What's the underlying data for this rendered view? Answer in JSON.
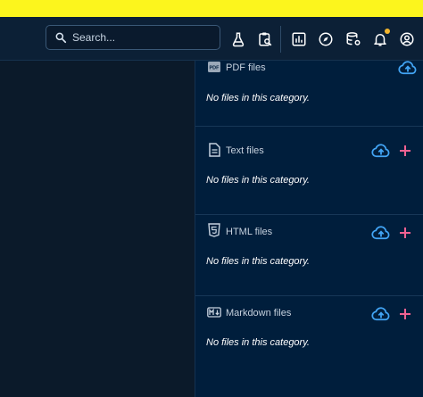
{
  "search": {
    "placeholder": "Search..."
  },
  "header_icons": [
    "flask-icon",
    "clipboard-search-icon",
    "chart-icon",
    "compass-icon",
    "database-settings-icon",
    "bell-icon",
    "account-icon"
  ],
  "colors": {
    "banner": "#fcf51d",
    "accent_blue": "#42a5f5",
    "accent_pink": "#f06292",
    "badge": "#f3b52d"
  },
  "sections": [
    {
      "title": "PDF files",
      "empty": "No files in this category.",
      "icon": "pdf-icon"
    },
    {
      "title": "Text files",
      "empty": "No files in this category.",
      "icon": "text-file-icon"
    },
    {
      "title": "HTML files",
      "empty": "No files in this category.",
      "icon": "html5-icon"
    },
    {
      "title": "Markdown files",
      "empty": "No files in this category.",
      "icon": "markdown-icon"
    }
  ]
}
